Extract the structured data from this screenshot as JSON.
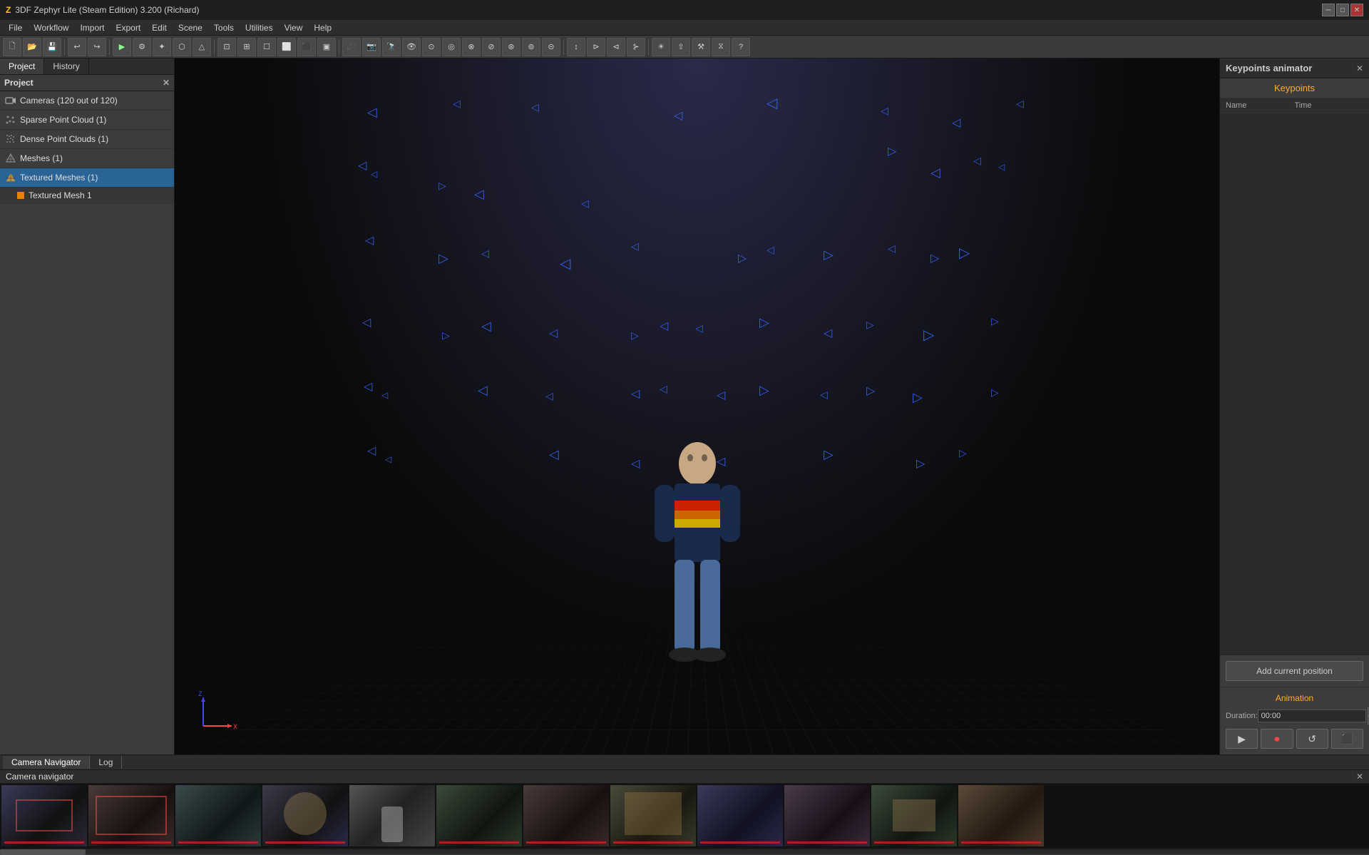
{
  "titlebar": {
    "title": "3DF Zephyr Lite (Steam Edition) 3.200 (Richard)",
    "icon": "Z"
  },
  "menubar": {
    "items": [
      "File",
      "Workflow",
      "Import",
      "Export",
      "Edit",
      "Scene",
      "Tools",
      "Utilities",
      "View",
      "Help"
    ]
  },
  "left_panel": {
    "tabs": [
      "Project",
      "History"
    ],
    "header": "Project",
    "tree": [
      {
        "label": "Cameras (120 out of 120)",
        "icon": "cam"
      },
      {
        "label": "Sparse Point Cloud (1)",
        "icon": "sparse"
      },
      {
        "label": "Dense Point Clouds (1)",
        "icon": "dense"
      },
      {
        "label": "Meshes (1)",
        "icon": "mesh"
      },
      {
        "label": "Textured Meshes (1)",
        "icon": "textured",
        "active": true
      },
      {
        "label": "Textured Mesh 1",
        "icon": "dot",
        "sub": true
      }
    ]
  },
  "viewport": {
    "label": "3D Viewport"
  },
  "right_panel": {
    "title": "Keypoints animator",
    "section": "Keypoints",
    "columns": [
      "Name",
      "Time"
    ],
    "add_button": "Add current position",
    "animation": {
      "title": "Animation",
      "duration_label": "Duration:",
      "duration_value": "00:00"
    }
  },
  "bottom": {
    "tabs": [
      "Camera Navigator",
      "Log"
    ],
    "active_tab": "Camera Navigator",
    "camera_navigator_label": "Camera navigator"
  },
  "toolbar": {
    "groups": [
      [
        "⟳",
        "⟲",
        "☐"
      ],
      [
        "▷",
        "◁",
        "⊕",
        "◉",
        "⊗",
        "◈",
        "◆",
        "◇"
      ],
      [
        "↩",
        "↪"
      ],
      [
        "⊡",
        "⊠",
        "⊞",
        "⊟",
        "⊘",
        "⊙",
        "⊚",
        "⊛",
        "⊜",
        "⊝",
        "⊞",
        "⊟",
        "⊠"
      ],
      [
        "↕",
        "⊳",
        "⊲",
        "⊱",
        "⊰",
        "⊯",
        "⊮"
      ],
      [
        "⊫",
        "⊪",
        "⊩",
        "⊨",
        "⊧",
        "?"
      ]
    ]
  }
}
